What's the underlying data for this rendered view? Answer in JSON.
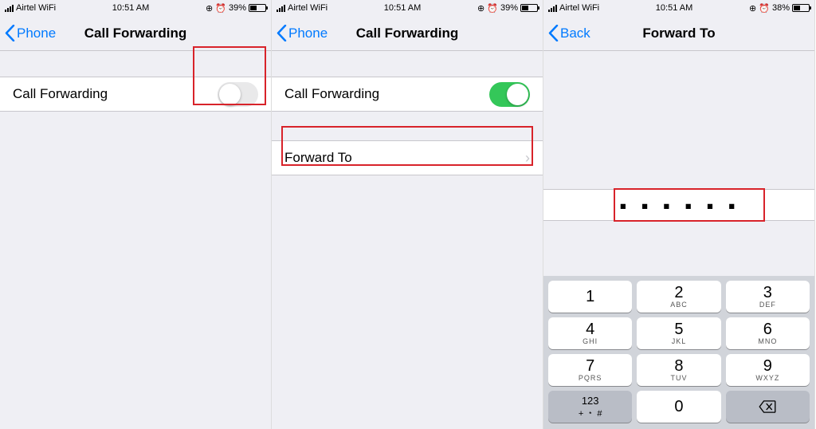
{
  "status": {
    "carrier": "Airtel WiFi",
    "time": "10:51 AM",
    "battery_1_2": "39%",
    "battery_3": "38%"
  },
  "nav": {
    "back_phone": "Phone",
    "back_back": "Back",
    "title_call_forwarding": "Call Forwarding",
    "title_forward_to": "Forward To"
  },
  "cells": {
    "call_forwarding_label": "Call Forwarding",
    "forward_to_label": "Forward To"
  },
  "input": {
    "number_obscured": "▪ ▪ ▪  ▪ ▪ ▪"
  },
  "keypad": {
    "mode": "123",
    "symbols": "+ ﹡ #",
    "keys": [
      {
        "num": "1",
        "letters": ""
      },
      {
        "num": "2",
        "letters": "ABC"
      },
      {
        "num": "3",
        "letters": "DEF"
      },
      {
        "num": "4",
        "letters": "GHI"
      },
      {
        "num": "5",
        "letters": "JKL"
      },
      {
        "num": "6",
        "letters": "MNO"
      },
      {
        "num": "7",
        "letters": "PQRS"
      },
      {
        "num": "8",
        "letters": "TUV"
      },
      {
        "num": "9",
        "letters": "WXYZ"
      },
      {
        "num": "0",
        "letters": ""
      }
    ]
  }
}
